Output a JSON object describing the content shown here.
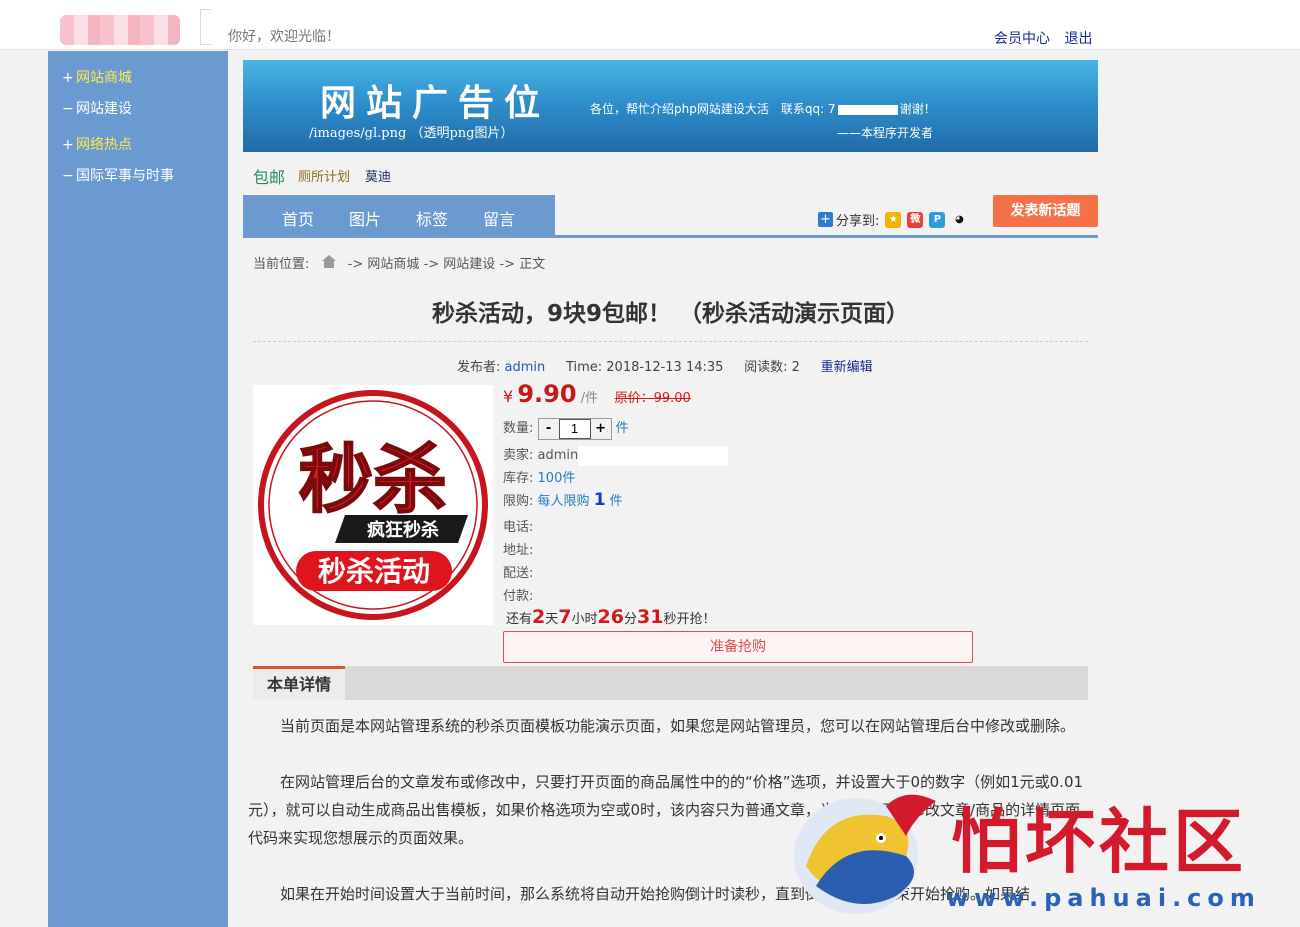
{
  "header": {
    "welcome": "你好，欢迎光临！",
    "member_center": "会员中心",
    "logout": "退出"
  },
  "sidebar": {
    "items": [
      {
        "mark": "+",
        "label": "网站商城",
        "color": "#ffe94a"
      },
      {
        "mark": "−",
        "label": "网站建设",
        "color": "#ffffff"
      },
      {
        "mark": "+",
        "label": "网络热点",
        "color": "#ffe94a"
      },
      {
        "mark": "−",
        "label": "国际军事与时事",
        "color": "#ffffff"
      }
    ]
  },
  "banner": {
    "title": "网站广告位",
    "path": "/images/gl.png （透明png图片）",
    "note_prefix": "各位，帮忙介绍php网站建设大活　联系qq: 7",
    "note_suffix": "谢谢！",
    "author": "——本程序开发者"
  },
  "tags": [
    "包邮",
    "厕所计划",
    "莫迪"
  ],
  "nav": [
    "首页",
    "图片",
    "标签",
    "留言"
  ],
  "share": {
    "label": "分享到:",
    "icons": [
      "qzone-icon",
      "weibo-icon",
      "tencent-weibo-icon",
      "qq-icon"
    ]
  },
  "post_button": "发表新话题",
  "breadcrumb": {
    "prefix": "当前位置:",
    "sep": "->",
    "items": [
      "网站商城",
      "网站建设",
      "正文"
    ]
  },
  "article": {
    "title": "秒杀活动，9块9包邮！ （秒杀活动演示页面）",
    "publisher_label": "发布者:",
    "publisher": "admin",
    "time_label": "Time:",
    "time": "2018-12-13 14:35",
    "views_label": "阅读数:",
    "views": "2",
    "reedit": "重新编辑"
  },
  "product": {
    "image_texts": [
      "秒杀",
      "疯狂秒杀",
      "秒杀活动"
    ],
    "currency": "¥",
    "price": "9.90",
    "price_unit": "/件",
    "original_price": "原价：99.00",
    "qty_label": "数量:",
    "qty_minus": "-",
    "qty_value": "1",
    "qty_plus": "+",
    "qty_unit": "件",
    "seller_label": "卖家:",
    "seller": "admin",
    "stock_label": "库存:",
    "stock": "100件",
    "limit_label": "限购:",
    "limit_text": "每人限购",
    "limit_num": "1",
    "limit_unit": "件",
    "phone_label": "电话:",
    "address_label": "地址:",
    "delivery_label": "配送:",
    "payment_label": "付款:",
    "countdown": {
      "prefix": "还有",
      "days": "2",
      "days_unit": "天",
      "hours": "7",
      "hours_unit": "小时",
      "minutes": "26",
      "minutes_unit": "分",
      "seconds": "31",
      "seconds_unit": "秒开抢！"
    },
    "buy_button": "准备抢购"
  },
  "detail": {
    "tab": "本单详情",
    "paragraphs": [
      "当前页面是本网站管理系统的秒杀页面模板功能演示页面，如果您是网站管理员，您可以在网站管理后台中修改或删除。",
      "在网站管理后台的文章发布或修改中，只要打开页面的商品属性中的的“价格”选项，并设置大于0的数字（例如1元或0.01元），就可以自动生成商品出售模板，如果价格选项为空或0时，该内容只为普通文章，当然您也可以修改文章/商品的详情页面代码来实现您想展示的页面效果。",
      "如果在开始时间设置大于当前时间，那么系统将自动开始抢购倒计时读秒，直到倒计时读秒结束开始抢购。如果结"
    ]
  },
  "watermark": {
    "text": "怕坏社区",
    "url": "www.pahuai.com"
  }
}
